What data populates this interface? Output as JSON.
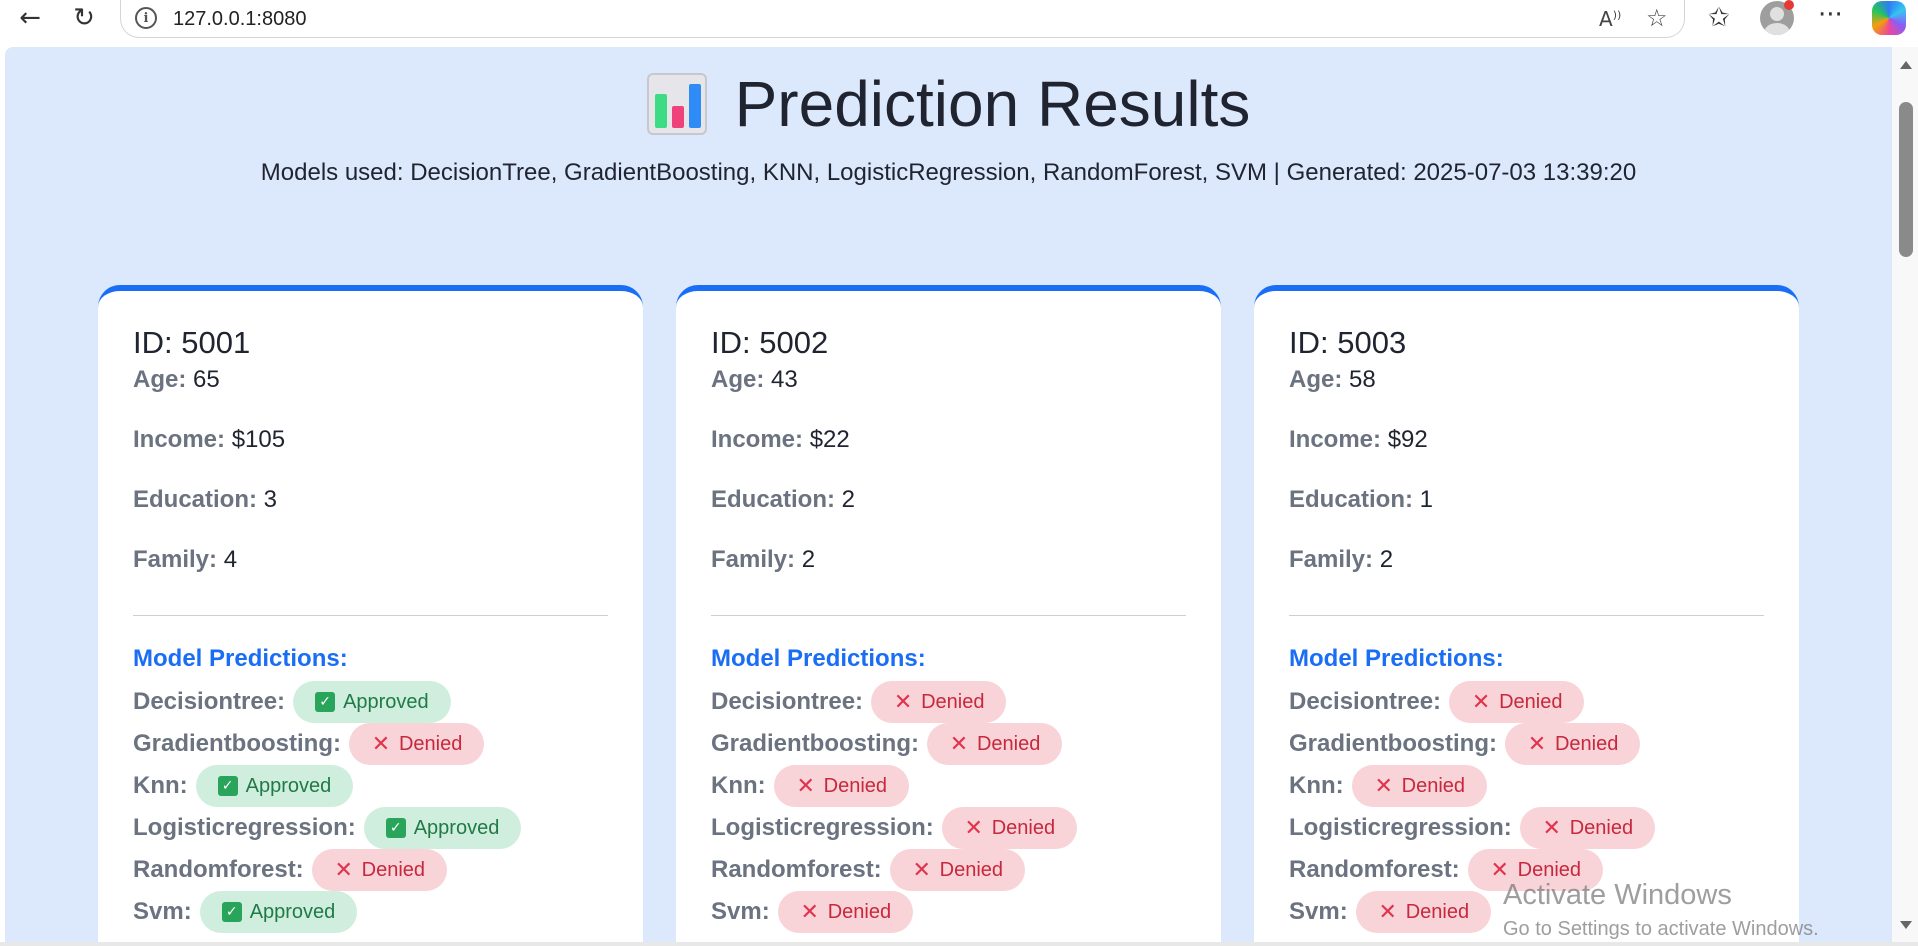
{
  "browser": {
    "url": "127.0.0.1:8080",
    "back_icon": "back-arrow-icon",
    "refresh_icon": "refresh-icon"
  },
  "header": {
    "title": "Prediction Results",
    "subtitle": "Models used: DecisionTree, GradientBoosting, KNN, LogisticRegression, RandomForest, SVM | Generated: 2025-07-03 13:39:20"
  },
  "labels": {
    "age": "Age:",
    "income": "Income:",
    "education": "Education:",
    "family": "Family:",
    "model_predictions": "Model Predictions:"
  },
  "colors": {
    "accent": "#1a6ef5",
    "background": "#dce8fb",
    "approved_bg": "#cfeedd",
    "approved_text": "#207a47",
    "denied_bg": "#f8d3d8",
    "denied_text": "#c8283d"
  },
  "cards": [
    {
      "id": "ID: 5001",
      "age": "65",
      "income": "$105",
      "education": "3",
      "family": "4",
      "predictions": [
        {
          "model": "Decisiontree:",
          "result": "Approved"
        },
        {
          "model": "Gradientboosting:",
          "result": "Denied"
        },
        {
          "model": "Knn:",
          "result": "Approved"
        },
        {
          "model": "Logisticregression:",
          "result": "Approved"
        },
        {
          "model": "Randomforest:",
          "result": "Denied"
        },
        {
          "model": "Svm:",
          "result": "Approved"
        }
      ]
    },
    {
      "id": "ID: 5002",
      "age": "43",
      "income": "$22",
      "education": "2",
      "family": "2",
      "predictions": [
        {
          "model": "Decisiontree:",
          "result": "Denied"
        },
        {
          "model": "Gradientboosting:",
          "result": "Denied"
        },
        {
          "model": "Knn:",
          "result": "Denied"
        },
        {
          "model": "Logisticregression:",
          "result": "Denied"
        },
        {
          "model": "Randomforest:",
          "result": "Denied"
        },
        {
          "model": "Svm:",
          "result": "Denied"
        }
      ]
    },
    {
      "id": "ID: 5003",
      "age": "58",
      "income": "$92",
      "education": "1",
      "family": "2",
      "predictions": [
        {
          "model": "Decisiontree:",
          "result": "Denied"
        },
        {
          "model": "Gradientboosting:",
          "result": "Denied"
        },
        {
          "model": "Knn:",
          "result": "Denied"
        },
        {
          "model": "Logisticregression:",
          "result": "Denied"
        },
        {
          "model": "Randomforest:",
          "result": "Denied"
        },
        {
          "model": "Svm:",
          "result": "Denied"
        }
      ]
    }
  ],
  "watermark": {
    "line1": "Activate Windows",
    "line2": "Go to Settings to activate Windows."
  }
}
